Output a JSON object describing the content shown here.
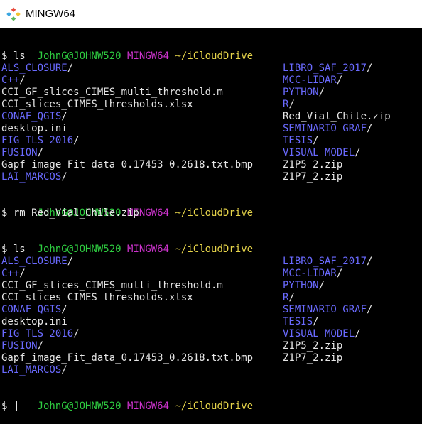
{
  "window": {
    "title": "MINGW64"
  },
  "colors": {
    "user": "#2ecc40",
    "host": "#cc33cc",
    "path": "#e6d44a",
    "dir": "#6a6aff",
    "text": "#e6e6e6",
    "background": "#000000"
  },
  "prompt": {
    "user": "JohnG@JOHNW520",
    "host": "MINGW64",
    "path": "~/iCloudDrive"
  },
  "cmds": {
    "ls": "$ ls",
    "rm": "$ rm Red_Vial_Chile.zip",
    "empty": "$ "
  },
  "listing1": {
    "rows": [
      {
        "left": {
          "text": "ALS_CLOSURE",
          "sep": "/",
          "dir": true
        },
        "right": {
          "text": "LIBRO_SAF_2017",
          "sep": "/",
          "dir": true
        }
      },
      {
        "left": {
          "text": "C++",
          "sep": "/",
          "dir": true
        },
        "right": {
          "text": "MCC-LIDAR",
          "sep": "/",
          "dir": true
        }
      },
      {
        "left": {
          "text": "CCI_GF_slices_CIMES_multi_threshold.m",
          "sep": "",
          "dir": false
        },
        "right": {
          "text": "PYTHON",
          "sep": "/",
          "dir": true
        }
      },
      {
        "left": {
          "text": "CCI_slices_CIMES_thresholds.xlsx",
          "sep": "",
          "dir": false
        },
        "right": {
          "text": "R",
          "sep": "/",
          "dir": true
        }
      },
      {
        "left": {
          "text": "CONAF_QGIS",
          "sep": "/",
          "dir": true
        },
        "right": {
          "text": "Red_Vial_Chile.zip",
          "sep": "",
          "dir": false
        }
      },
      {
        "left": {
          "text": "desktop.ini",
          "sep": "",
          "dir": false
        },
        "right": {
          "text": "SEMINARIO_GRAF",
          "sep": "/",
          "dir": true
        }
      },
      {
        "left": {
          "text": "FIG_TLS_2016",
          "sep": "/",
          "dir": true
        },
        "right": {
          "text": "TESIS",
          "sep": "/",
          "dir": true
        }
      },
      {
        "left": {
          "text": "FUSION",
          "sep": "/",
          "dir": true
        },
        "right": {
          "text": "VISUAL_MODEL",
          "sep": "/",
          "dir": true
        }
      },
      {
        "left": {
          "text": "Gapf_image_Fit_data_0.17453_0.2618.txt.bmp",
          "sep": "",
          "dir": false
        },
        "right": {
          "text": "Z1P5_2.zip",
          "sep": "",
          "dir": false
        }
      },
      {
        "left": {
          "text": "LAI_MARCOS",
          "sep": "/",
          "dir": true
        },
        "right": {
          "text": "Z1P7_2.zip",
          "sep": "",
          "dir": false
        }
      }
    ]
  },
  "listing2": {
    "rows": [
      {
        "left": {
          "text": "ALS_CLOSURE",
          "sep": "/",
          "dir": true
        },
        "right": {
          "text": "LIBRO_SAF_2017",
          "sep": "/",
          "dir": true
        }
      },
      {
        "left": {
          "text": "C++",
          "sep": "/",
          "dir": true
        },
        "right": {
          "text": "MCC-LIDAR",
          "sep": "/",
          "dir": true
        }
      },
      {
        "left": {
          "text": "CCI_GF_slices_CIMES_multi_threshold.m",
          "sep": "",
          "dir": false
        },
        "right": {
          "text": "PYTHON",
          "sep": "/",
          "dir": true
        }
      },
      {
        "left": {
          "text": "CCI_slices_CIMES_thresholds.xlsx",
          "sep": "",
          "dir": false
        },
        "right": {
          "text": "R",
          "sep": "/",
          "dir": true
        }
      },
      {
        "left": {
          "text": "CONAF_QGIS",
          "sep": "/",
          "dir": true
        },
        "right": {
          "text": "SEMINARIO_GRAF",
          "sep": "/",
          "dir": true
        }
      },
      {
        "left": {
          "text": "desktop.ini",
          "sep": "",
          "dir": false
        },
        "right": {
          "text": "TESIS",
          "sep": "/",
          "dir": true
        }
      },
      {
        "left": {
          "text": "FIG_TLS_2016",
          "sep": "/",
          "dir": true
        },
        "right": {
          "text": "VISUAL_MODEL",
          "sep": "/",
          "dir": true
        }
      },
      {
        "left": {
          "text": "FUSION",
          "sep": "/",
          "dir": true
        },
        "right": {
          "text": "Z1P5_2.zip",
          "sep": "",
          "dir": false
        }
      },
      {
        "left": {
          "text": "Gapf_image_Fit_data_0.17453_0.2618.txt.bmp",
          "sep": "",
          "dir": false
        },
        "right": {
          "text": "Z1P7_2.zip",
          "sep": "",
          "dir": false
        }
      },
      {
        "left": {
          "text": "LAI_MARCOS",
          "sep": "/",
          "dir": true
        },
        "right": null
      }
    ]
  }
}
